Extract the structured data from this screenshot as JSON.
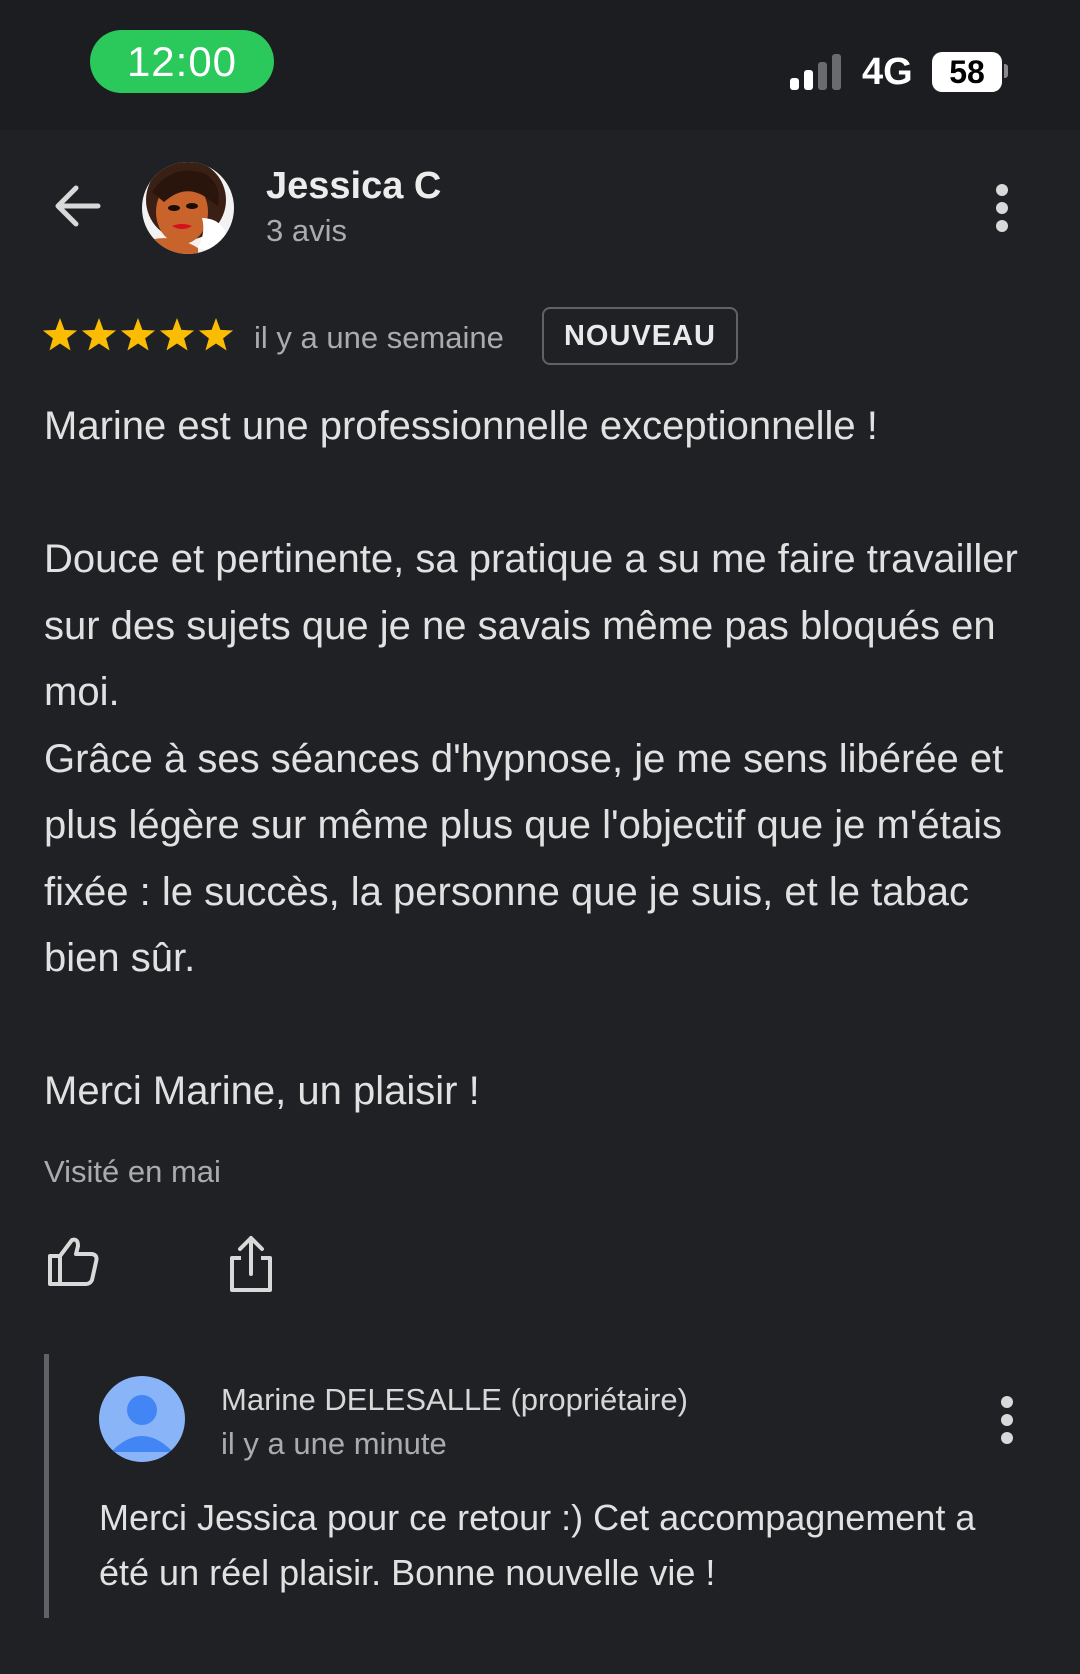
{
  "status_bar": {
    "time": "12:00",
    "network": "4G",
    "battery": "58",
    "accent_color": "#2bc95b"
  },
  "header": {
    "back_icon": "arrow-left-icon",
    "reviewer_name": "Jessica C",
    "reviewer_review_count": "3 avis",
    "more_icon": "more-vert-icon"
  },
  "review": {
    "rating": 5,
    "max_rating": 5,
    "star_color": "#fbbc04",
    "time_ago": "il y a une semaine",
    "badge": "NOUVEAU",
    "text": "Marine est une professionnelle exceptionnelle !\n\nDouce et pertinente, sa pratique a su me faire travailler sur des sujets que je ne savais même pas bloqués en moi.\nGrâce à ses séances d'hypnose, je me sens libérée et plus légère sur même plus que l'objectif que je m'étais fixée : le succès, la personne que je suis, et le tabac bien sûr.\n\nMerci Marine, un plaisir !",
    "visited": "Visité en mai",
    "like_icon": "thumb-up-icon",
    "share_icon": "share-icon"
  },
  "owner_reply": {
    "owner_name": "Marine DELESALLE (propriétaire)",
    "time_ago": "il y a une minute",
    "text": "Merci Jessica pour ce retour :) Cet accompagnement a été un réel plaisir. Bonne nouvelle vie !",
    "avatar_color": "#8ab4f8",
    "more_icon": "more-vert-icon"
  }
}
